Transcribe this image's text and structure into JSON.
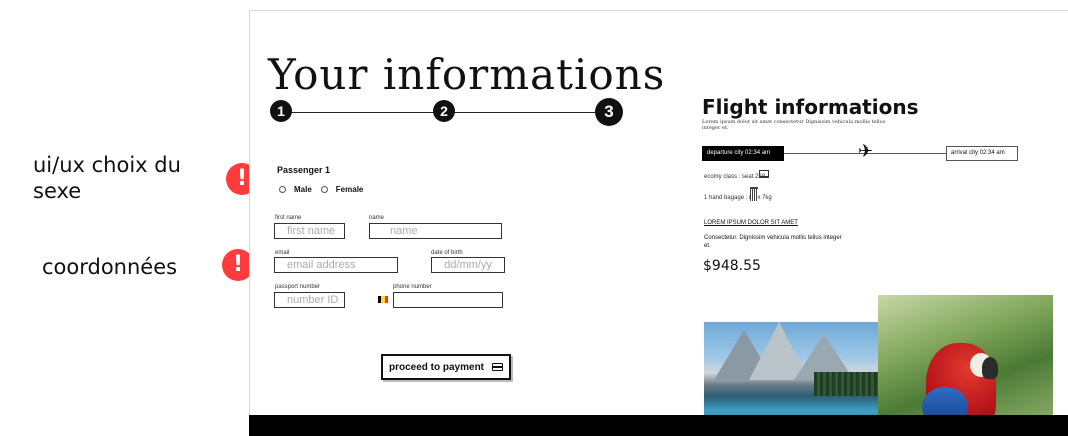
{
  "annotations": {
    "gender_note": "ui/ux choix du sexe",
    "contact_note": "coordonnées",
    "warning_glyph": "!"
  },
  "form": {
    "title": "Your informations",
    "steps": [
      "1",
      "2",
      "3"
    ],
    "passenger_label": "Passenger 1",
    "gender_options": [
      "Male",
      "Female"
    ],
    "first_name_label": "first name",
    "first_name_placeholder": "first name",
    "name_label": "name",
    "name_placeholder": "name",
    "email_label": "email",
    "email_placeholder": "email address",
    "dob_label": "date of birth",
    "dob_placeholder": "dd/mm/yy",
    "passport_label": "passport number",
    "passport_placeholder": "number ID",
    "phone_label": "phone number",
    "phone_value": "",
    "flag_colors": [
      "#000000",
      "#FDDA24",
      "#EF3340"
    ],
    "pay_button": "proceed to payment"
  },
  "flight": {
    "title": "Flight informations",
    "subtitle": "Lorem ipsum dolor sit amet consectetur Dignissim vehicula mollis tellus integer et.",
    "departure": "departure city  02:34 am",
    "arrival": "arrival city  02:34 am",
    "plane_icon": "airplane-icon",
    "class_info": "ecomy class : seat 228",
    "bag_info": "1 hand bagage : max 7kg",
    "link_text": "LOREM IPSUM DOLOR SIT AMET",
    "description": "Consectetur. Dignissim vehicula mollis tellus integer et.",
    "price": "$948.55"
  }
}
